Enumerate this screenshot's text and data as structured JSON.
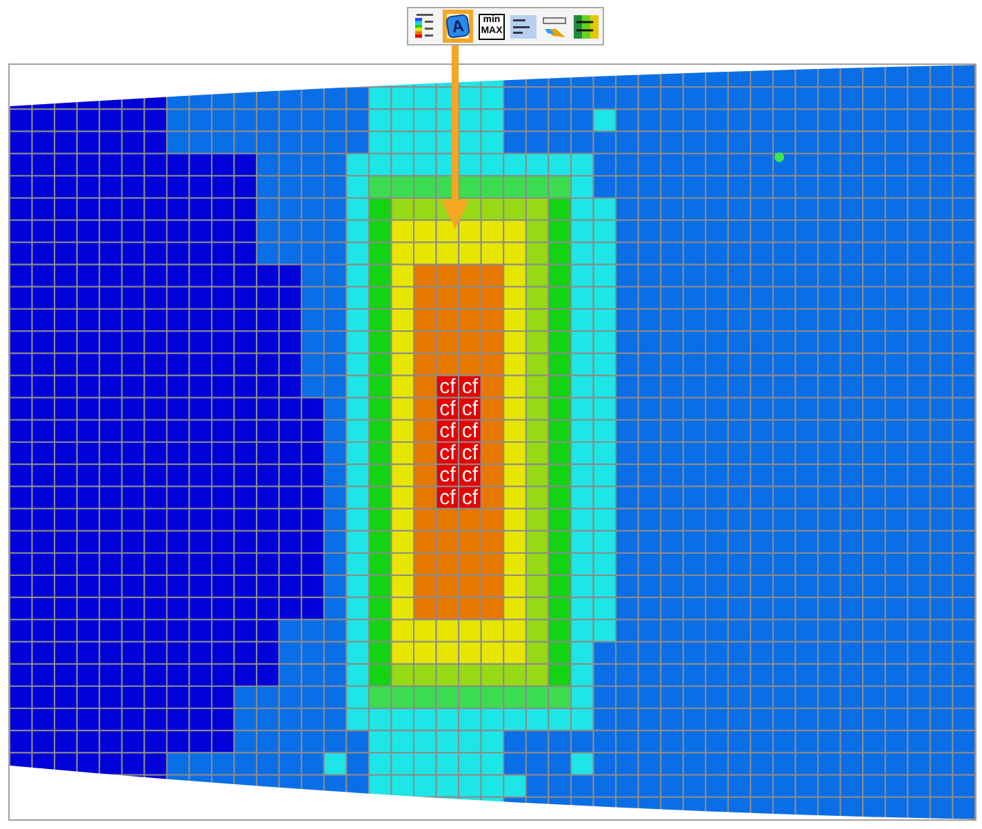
{
  "toolbar": [
    {
      "kind": "legend",
      "selected": false
    },
    {
      "kind": "label",
      "selected": true,
      "text": "A"
    },
    {
      "kind": "minmax",
      "selected": false,
      "lines": [
        "min",
        "MAX"
      ]
    },
    {
      "kind": "note",
      "selected": false
    },
    {
      "kind": "colorbar",
      "selected": false
    },
    {
      "kind": "contour",
      "selected": false
    }
  ],
  "mesh_label_rows": [
    [
      "cf",
      "cf"
    ],
    [
      "cf",
      "cf"
    ],
    [
      "cf",
      "cf"
    ],
    [
      "cf",
      "cf"
    ],
    [
      "cf",
      "cf"
    ],
    [
      "cf",
      "cf"
    ]
  ]
}
